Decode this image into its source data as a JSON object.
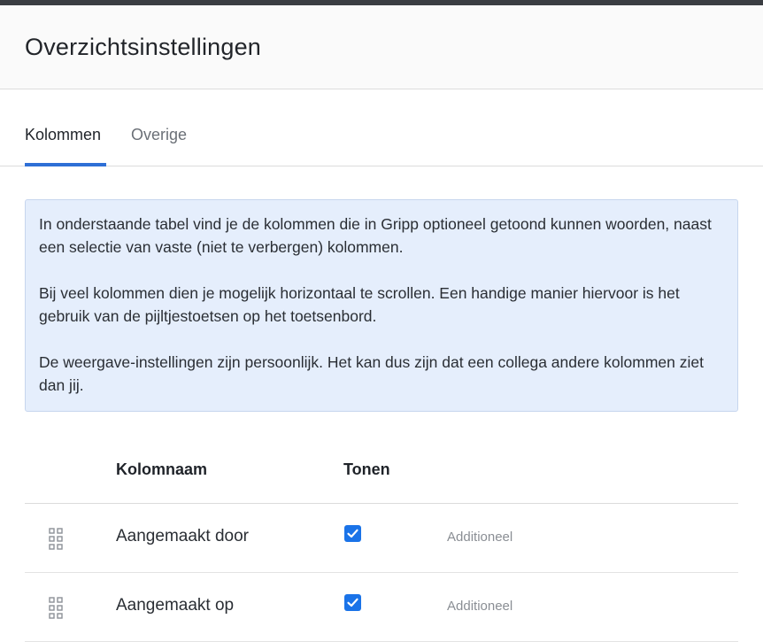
{
  "header": {
    "title": "Overzichtsinstellingen"
  },
  "tabs": [
    {
      "label": "Kolommen",
      "active": true
    },
    {
      "label": "Overige",
      "active": false
    }
  ],
  "info": {
    "paragraphs": [
      "In onderstaande tabel vind je de kolommen die in Gripp optioneel getoond kunnen woorden, naast een selectie van vaste (niet te verbergen) kolommen.",
      "Bij veel kolommen dien je mogelijk horizontaal te scrollen. Een handige manier hiervoor is het gebruik van de pijltjestoetsen op het toetsenbord.",
      "De weergave-instellingen zijn persoonlijk. Het kan dus zijn dat een collega andere kolommen ziet dan jij."
    ]
  },
  "table": {
    "headers": {
      "name": "Kolomnaam",
      "show": "Tonen"
    },
    "rows": [
      {
        "name": "Aangemaakt door",
        "checked": true,
        "type": "Additioneel"
      },
      {
        "name": "Aangemaakt op",
        "checked": true,
        "type": "Additioneel"
      }
    ]
  },
  "colors": {
    "accent": "#2e6fd6",
    "checkbox": "#1a73e8",
    "info_bg": "#e5eefc"
  }
}
